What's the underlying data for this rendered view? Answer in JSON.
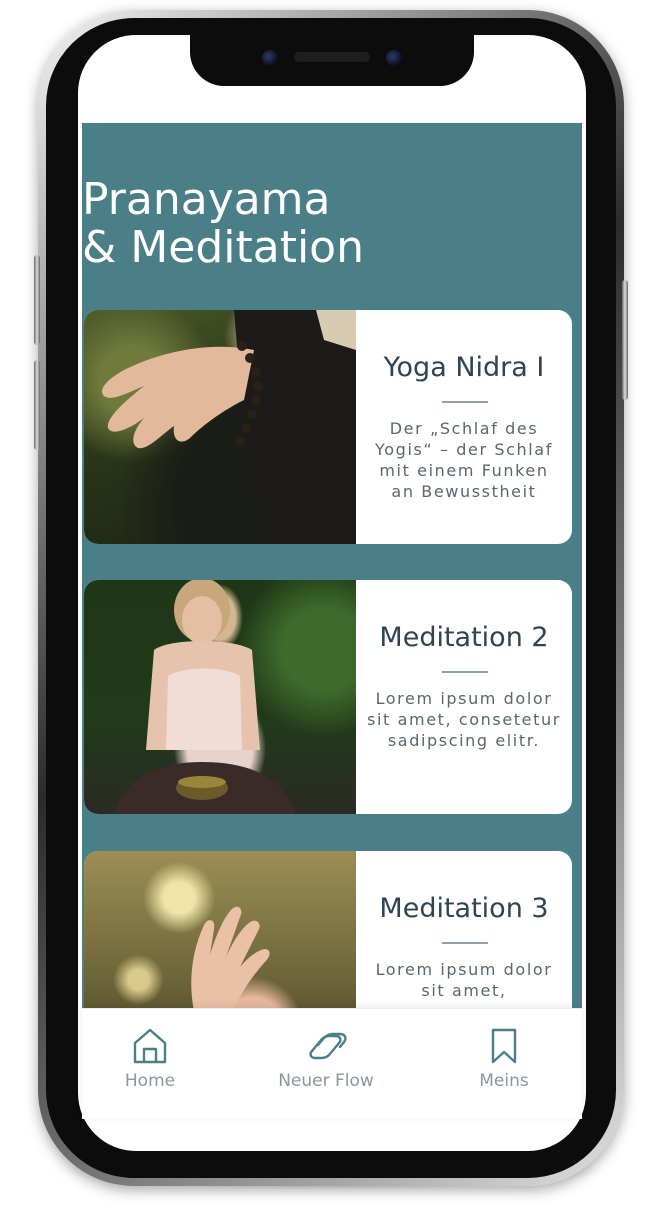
{
  "page": {
    "title_line1": "Pranayama",
    "title_line2": "& Meditation"
  },
  "cards": [
    {
      "title": "Yoga Nidra I",
      "description": "Der „Schlaf des Yogis“ – der Schlaf mit einem Funken an Bewusstheit"
    },
    {
      "title": "Meditation 2",
      "description": "Lorem ipsum dolor sit amet, consetetur sadipscing elitr."
    },
    {
      "title": "Meditation 3",
      "description": "Lorem ipsum dolor sit amet,"
    }
  ],
  "nav": {
    "home_label": "Home",
    "new_flow_label": "Neuer Flow",
    "mine_label": "Meins"
  },
  "colors": {
    "accent": "#4a7f88",
    "title_text": "#2f4453",
    "nav_icon": "#4a7f88",
    "nav_text": "#8b969d"
  },
  "icons": [
    "home-icon",
    "neuer-flow-icon",
    "bookmark-icon"
  ]
}
